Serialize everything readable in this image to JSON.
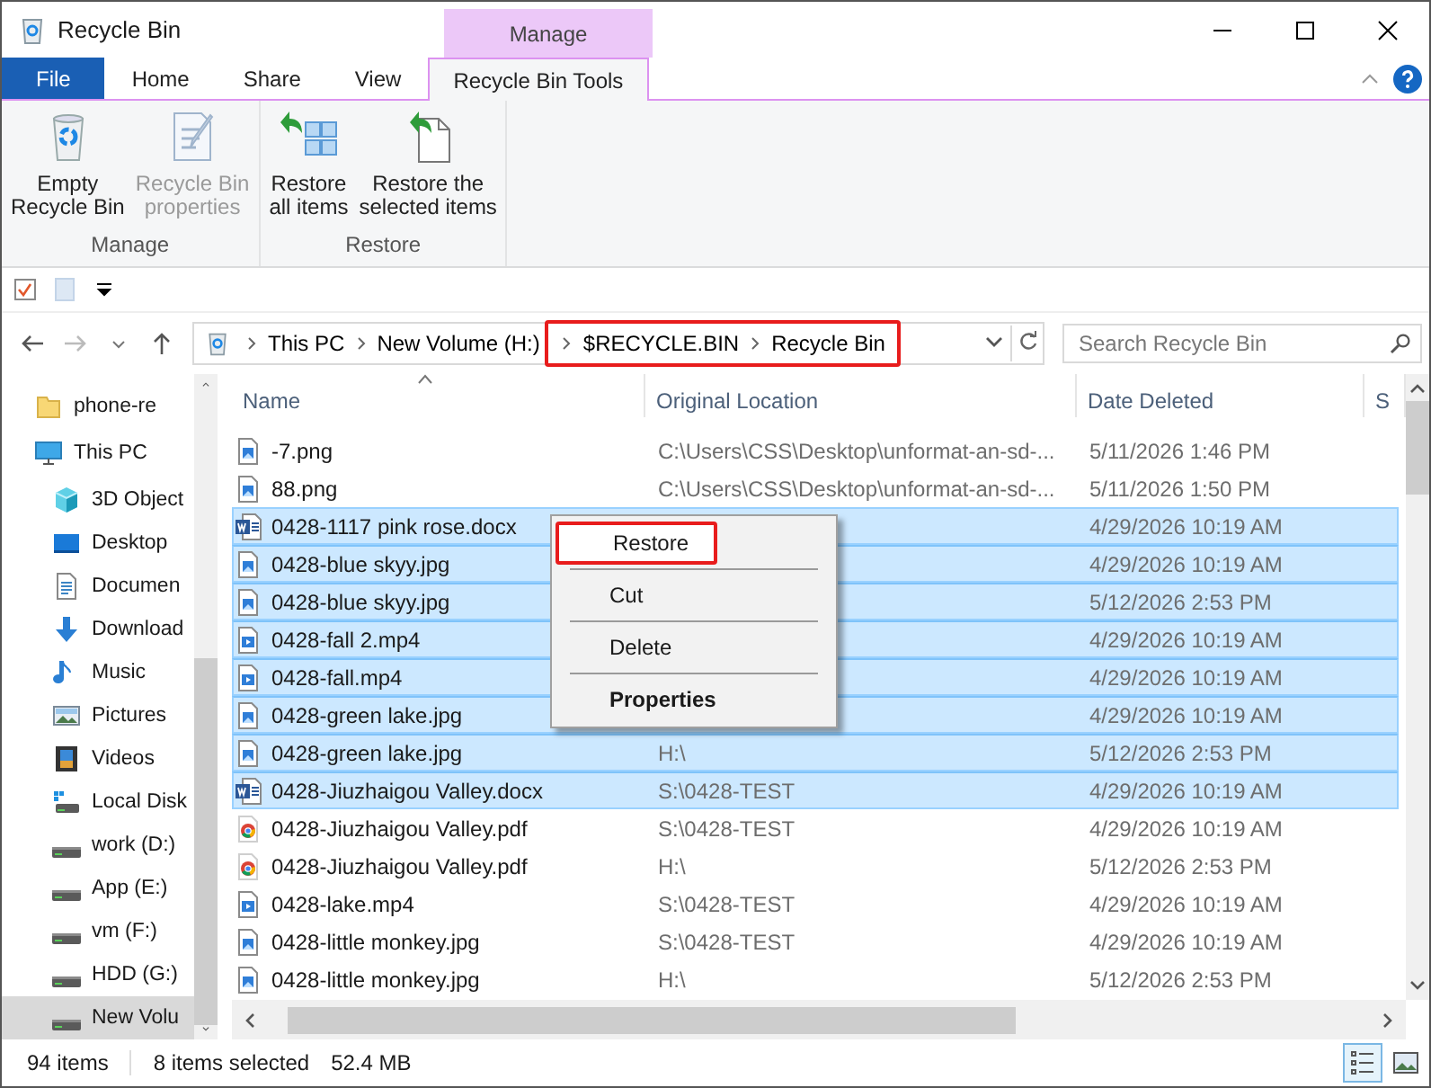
{
  "window": {
    "title": "Recycle Bin"
  },
  "ribbon": {
    "context_header": "Manage",
    "tabs": [
      {
        "label": "File",
        "kind": "file",
        "selected": false
      },
      {
        "label": "Home",
        "kind": "tab",
        "selected": false
      },
      {
        "label": "Share",
        "kind": "tab",
        "selected": false
      },
      {
        "label": "View",
        "kind": "tab",
        "selected": false
      },
      {
        "label": "Recycle Bin Tools",
        "kind": "context",
        "selected": true
      }
    ],
    "groups": [
      {
        "label": "Manage",
        "buttons": [
          {
            "lines": [
              "Empty",
              "Recycle Bin"
            ],
            "kind": "bin",
            "disabled": false
          },
          {
            "lines": [
              "Recycle Bin",
              "properties"
            ],
            "kind": "properties",
            "disabled": true
          }
        ]
      },
      {
        "label": "Restore",
        "buttons": [
          {
            "lines": [
              "Restore",
              "all items"
            ],
            "kind": "restore-all",
            "disabled": false
          },
          {
            "lines": [
              "Restore the",
              "selected items"
            ],
            "kind": "restore-selected",
            "disabled": false
          }
        ]
      }
    ]
  },
  "address": {
    "crumbs": [
      {
        "label": "This PC",
        "highlighted": false
      },
      {
        "label": "New Volume (H:)",
        "highlighted": false
      },
      {
        "label": "$RECYCLE.BIN",
        "highlighted": true
      },
      {
        "label": "Recycle Bin",
        "highlighted": true
      }
    ]
  },
  "search": {
    "placeholder": "Search Recycle Bin"
  },
  "sidebar": {
    "items": [
      {
        "label": "phone-re",
        "kind": "folder",
        "selected": false
      },
      {
        "label": "This PC",
        "kind": "pc",
        "selected": false
      },
      {
        "label": "3D Object",
        "kind": "cube",
        "selected": false
      },
      {
        "label": "Desktop",
        "kind": "desktop",
        "selected": false
      },
      {
        "label": "Documen",
        "kind": "documents",
        "selected": false
      },
      {
        "label": "Download",
        "kind": "downloads",
        "selected": false
      },
      {
        "label": "Music",
        "kind": "music",
        "selected": false
      },
      {
        "label": "Pictures",
        "kind": "pictures",
        "selected": false
      },
      {
        "label": "Videos",
        "kind": "videos",
        "selected": false
      },
      {
        "label": "Local Disk",
        "kind": "system-drive",
        "selected": false
      },
      {
        "label": "work (D:)",
        "kind": "drive",
        "selected": false
      },
      {
        "label": "App (E:)",
        "kind": "drive",
        "selected": false
      },
      {
        "label": "vm (F:)",
        "kind": "drive",
        "selected": false
      },
      {
        "label": "HDD (G:)",
        "kind": "drive",
        "selected": false
      },
      {
        "label": "New Volu",
        "kind": "drive",
        "selected": true
      }
    ]
  },
  "table": {
    "columns": [
      {
        "label": "Name",
        "sorted": true
      },
      {
        "label": "Original Location",
        "sorted": false
      },
      {
        "label": "Date Deleted",
        "sorted": false
      },
      {
        "label": "S",
        "sorted": false
      }
    ],
    "rows": [
      {
        "name": "-7.png",
        "location": "C:\\Users\\CSS\\Desktop\\unformat-an-sd-...",
        "date": "5/11/2026 1:46 PM",
        "kind": "image",
        "selected": false
      },
      {
        "name": "88.png",
        "location": "C:\\Users\\CSS\\Desktop\\unformat-an-sd-...",
        "date": "5/11/2026 1:50 PM",
        "kind": "image",
        "selected": false
      },
      {
        "name": "0428-1117 pink rose.docx",
        "date": "4/29/2026 10:19 AM",
        "kind": "word",
        "selected": true
      },
      {
        "name": "0428-blue skyy.jpg",
        "date": "4/29/2026 10:19 AM",
        "kind": "image",
        "selected": true
      },
      {
        "name": "0428-blue skyy.jpg",
        "date": "5/12/2026 2:53 PM",
        "kind": "image",
        "selected": true
      },
      {
        "name": "0428-fall 2.mp4",
        "date": "4/29/2026 10:19 AM",
        "kind": "video",
        "selected": true
      },
      {
        "name": "0428-fall.mp4",
        "date": "4/29/2026 10:19 AM",
        "kind": "video",
        "selected": true
      },
      {
        "name": "0428-green lake.jpg",
        "date": "4/29/2026 10:19 AM",
        "kind": "image",
        "selected": true
      },
      {
        "name": "0428-green lake.jpg",
        "location": "H:\\",
        "date": "5/12/2026 2:53 PM",
        "kind": "image",
        "selected": true
      },
      {
        "name": "0428-Jiuzhaigou Valley.docx",
        "location": "S:\\0428-TEST",
        "date": "4/29/2026 10:19 AM",
        "kind": "word",
        "selected": true
      },
      {
        "name": "0428-Jiuzhaigou Valley.pdf",
        "location": "S:\\0428-TEST",
        "date": "4/29/2026 10:19 AM",
        "kind": "pdf",
        "selected": false
      },
      {
        "name": "0428-Jiuzhaigou Valley.pdf",
        "location": "H:\\",
        "date": "5/12/2026 2:53 PM",
        "kind": "pdf",
        "selected": false
      },
      {
        "name": "0428-lake.mp4",
        "location": "S:\\0428-TEST",
        "date": "4/29/2026 10:19 AM",
        "kind": "video",
        "selected": false
      },
      {
        "name": "0428-little monkey.jpg",
        "location": "S:\\0428-TEST",
        "date": "4/29/2026 10:19 AM",
        "kind": "image",
        "selected": false
      },
      {
        "name": "0428-little monkey.jpg",
        "location": "H:\\",
        "date": "5/12/2026 2:53 PM",
        "kind": "image",
        "selected": false
      }
    ]
  },
  "context_menu": {
    "items": [
      {
        "label": "Restore",
        "bold": false,
        "highlighted": true
      },
      {
        "label": "Cut",
        "bold": false,
        "highlighted": false
      },
      {
        "label": "Delete",
        "bold": false,
        "highlighted": false
      },
      {
        "label": "Properties",
        "bold": true,
        "highlighted": false
      }
    ]
  },
  "status_bar": {
    "item_count": "94 items",
    "selection": "8 items selected",
    "size": "52.4 MB"
  },
  "views": [
    {
      "kind": "details",
      "selected": true
    },
    {
      "kind": "large-icons",
      "selected": false
    }
  ]
}
